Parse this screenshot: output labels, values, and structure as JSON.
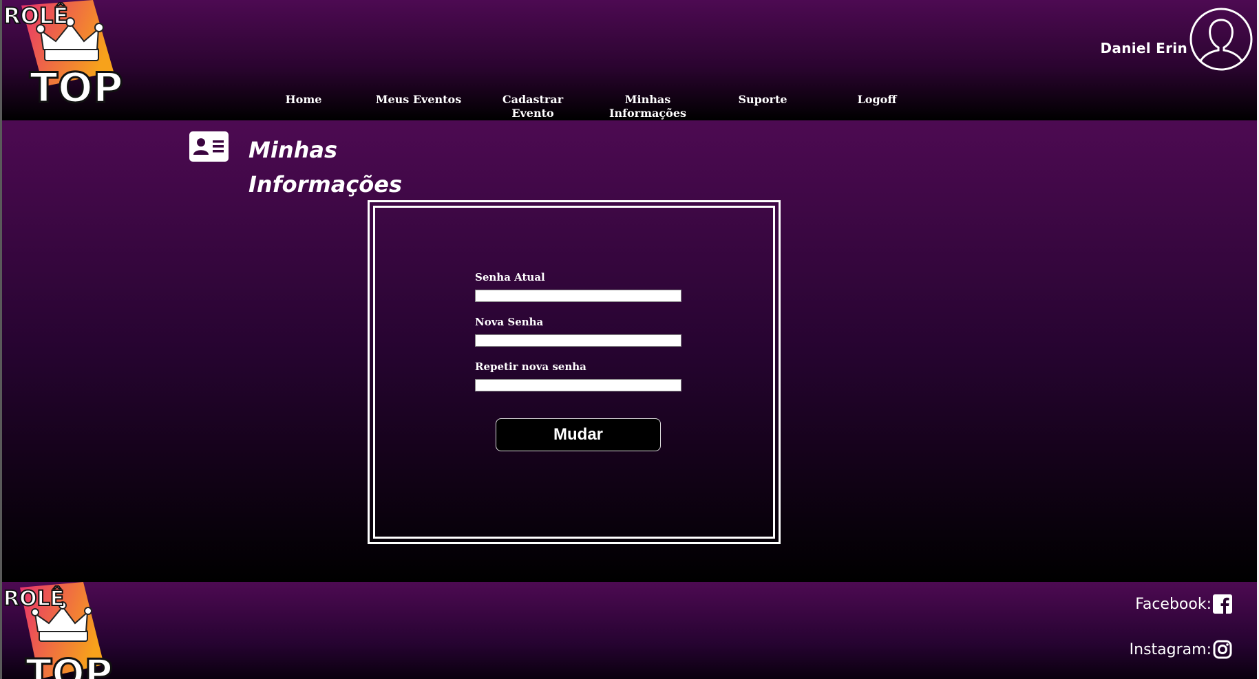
{
  "brand": {
    "line1": "ROLÊ",
    "line2": "TOP"
  },
  "nav": {
    "items": [
      {
        "label": "Home"
      },
      {
        "label": "Meus Eventos"
      },
      {
        "label": "Cadastrar Evento"
      },
      {
        "label": "Minhas Informações"
      },
      {
        "label": "Suporte"
      },
      {
        "label": "Logoff"
      }
    ]
  },
  "user": {
    "name": "Daniel Erin",
    "avatar_icon": "user-avatar-icon"
  },
  "page": {
    "title": "Minhas Informações",
    "title_icon": "contact-card-icon"
  },
  "form": {
    "current_password_label": "Senha Atual",
    "current_password_value": "",
    "new_password_label": "Nova Senha",
    "new_password_value": "",
    "repeat_password_label": "Repetir nova senha",
    "repeat_password_value": "",
    "submit_label": "Mudar"
  },
  "footer": {
    "facebook_label": "Facebook:",
    "facebook_icon": "facebook-icon",
    "instagram_label": "Instagram:",
    "instagram_icon": "instagram-icon"
  },
  "colors": {
    "background_top": "#4d0a52",
    "background_bottom": "#000000",
    "logo_orange": "#f7a21b",
    "logo_pink": "#e6316e"
  }
}
